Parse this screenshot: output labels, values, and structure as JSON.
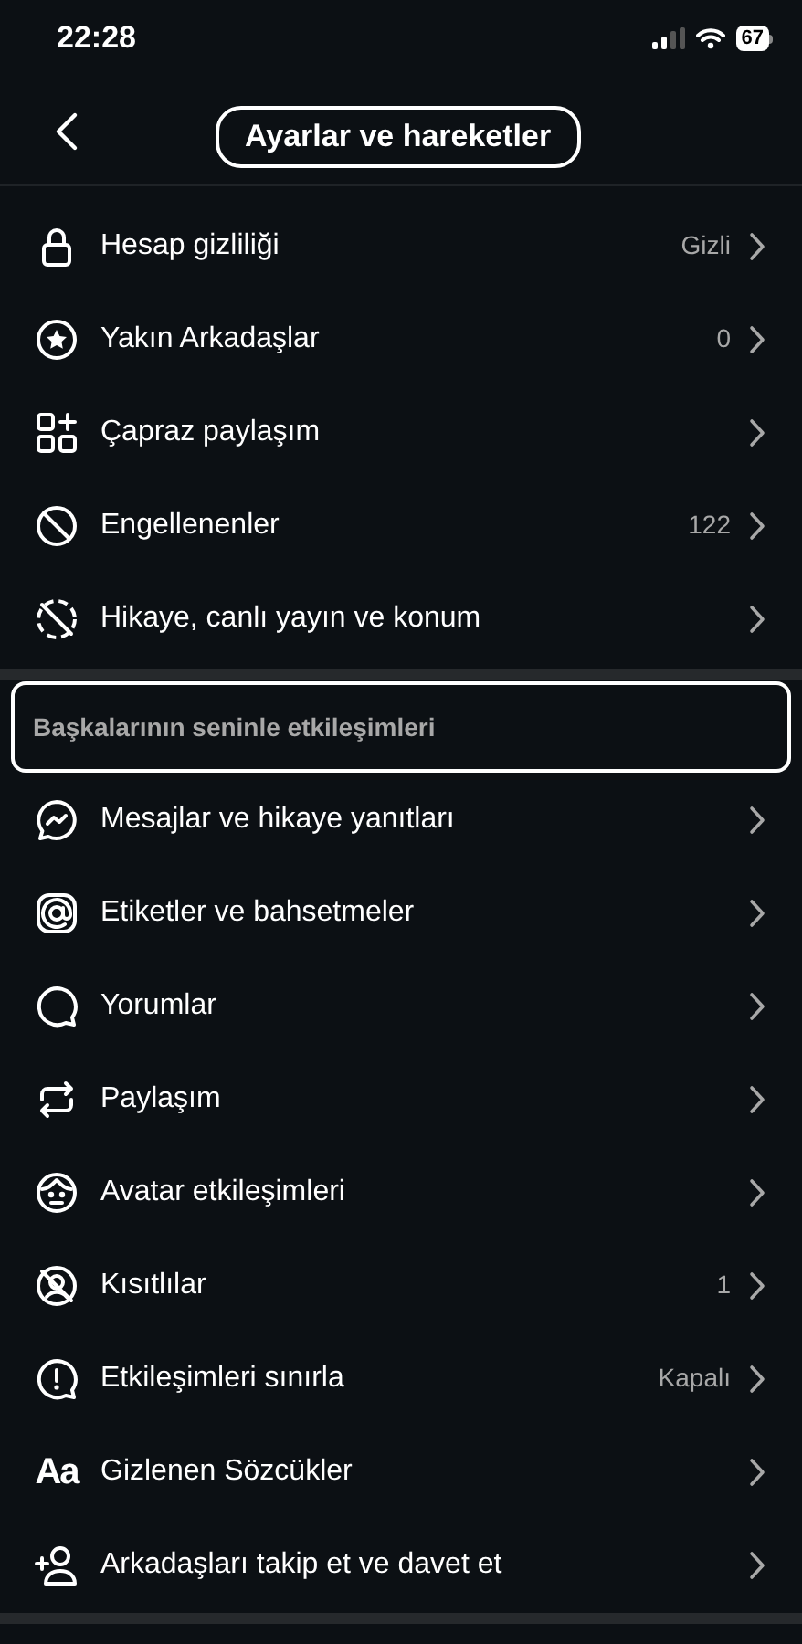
{
  "status_bar": {
    "time": "22:28",
    "battery": "67"
  },
  "header": {
    "title": "Ayarlar ve hareketler"
  },
  "privacy_items": [
    {
      "label": "Hesap gizliliği",
      "value": "Gizli"
    },
    {
      "label": "Yakın Arkadaşlar",
      "value": "0"
    },
    {
      "label": "Çapraz paylaşım"
    },
    {
      "label": "Engellenenler",
      "value": "122"
    },
    {
      "label": "Hikaye, canlı yayın ve konum"
    }
  ],
  "interactions_section": {
    "title": "Başkalarının seninle etkileşimleri",
    "items": [
      {
        "label": "Mesajlar ve hikaye yanıtları"
      },
      {
        "label": "Etiketler ve bahsetmeler"
      },
      {
        "label": "Yorumlar"
      },
      {
        "label": "Paylaşım"
      },
      {
        "label": "Avatar etkileşimleri"
      },
      {
        "label": "Kısıtlılar",
        "value": "1"
      },
      {
        "label": "Etkileşimleri sınırla",
        "value": "Kapalı"
      },
      {
        "icon_text": "Aa",
        "label": "Gizlenen Sözcükler"
      },
      {
        "label": "Arkadaşları takip et ve davet et"
      }
    ]
  }
}
